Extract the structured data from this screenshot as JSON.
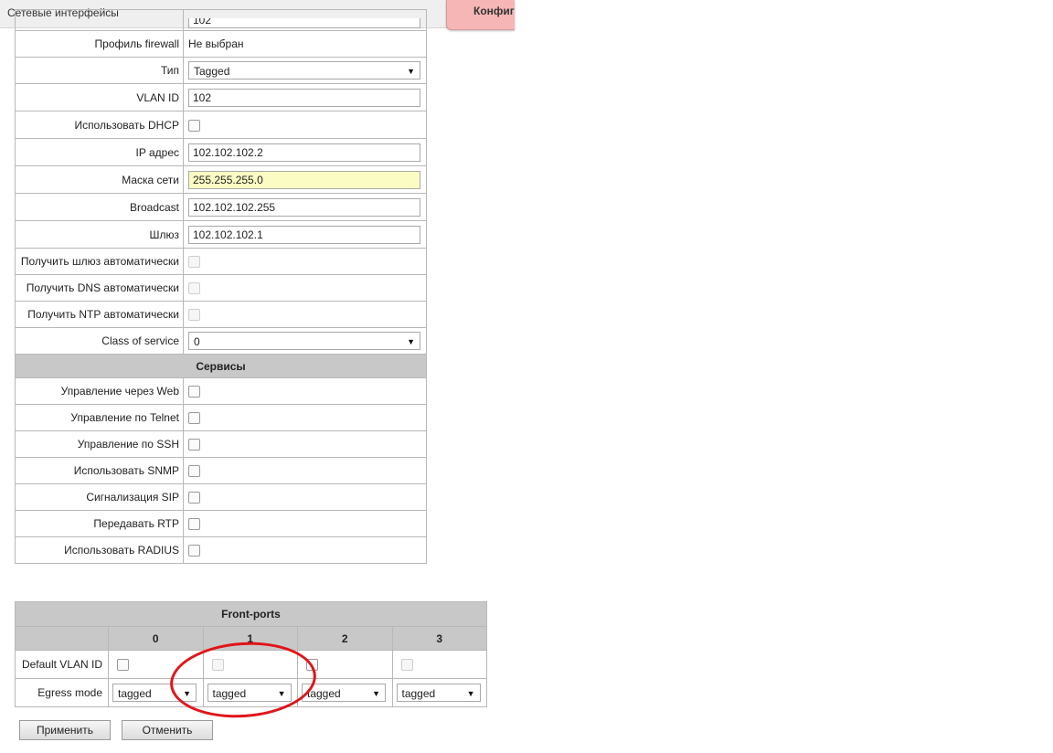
{
  "header": {
    "title": "Сетевые интерфейсы",
    "config_tab_label": "Конфиг"
  },
  "form": {
    "partial_top_value": "102",
    "firewall_profile_label": "Профиль firewall",
    "firewall_profile_value": "Не выбран",
    "type_label": "Тип",
    "type_value": "Tagged",
    "vlan_id_label": "VLAN ID",
    "vlan_id_value": "102",
    "use_dhcp_label": "Использовать DHCP",
    "ip_label": "IP адрес",
    "ip_value": "102.102.102.2",
    "mask_label": "Маска сети",
    "mask_value": "255.255.255.0",
    "broadcast_label": "Broadcast",
    "broadcast_value": "102.102.102.255",
    "gateway_label": "Шлюз",
    "gateway_value": "102.102.102.1",
    "auto_gateway_label": "Получить шлюз автоматически",
    "auto_dns_label": "Получить DNS автоматически",
    "auto_ntp_label": "Получить NTP автоматически",
    "cos_label": "Class of service",
    "cos_value": "0"
  },
  "services": {
    "header": "Сервисы",
    "items": [
      "Управление через Web",
      "Управление по Telnet",
      "Управление по SSH",
      "Использовать SNMP",
      "Сигнализация SIP",
      "Передавать RTP",
      "Использовать RADIUS"
    ]
  },
  "ports": {
    "header": "Front-ports",
    "columns": [
      "0",
      "1",
      "2",
      "3"
    ],
    "default_vlan_label": "Default VLAN ID",
    "egress_label": "Egress mode",
    "egress_values": [
      "tagged",
      "tagged",
      "tagged",
      "tagged"
    ]
  },
  "buttons": {
    "apply": "Применить",
    "cancel": "Отменить"
  },
  "colors": {
    "highlight_field": "#fbfbc4",
    "section_header": "#c8c8c8",
    "annotation_circle": "#e0151a",
    "config_tab": "#f6b6b6"
  }
}
